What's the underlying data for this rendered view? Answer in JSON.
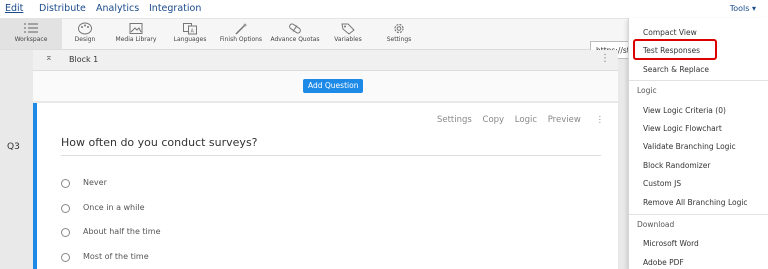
{
  "nav": {
    "tabs": [
      {
        "label": "Edit",
        "active": true
      },
      {
        "label": "Distribute"
      },
      {
        "label": "Analytics"
      },
      {
        "label": "Integration"
      }
    ],
    "tools_label": "Tools"
  },
  "toolbar": {
    "items": [
      {
        "label": "Workspace",
        "icon": "list-icon"
      },
      {
        "label": "Design",
        "icon": "palette-icon"
      },
      {
        "label": "Media Library",
        "icon": "image-icon"
      },
      {
        "label": "Languages",
        "icon": "translate-icon"
      },
      {
        "label": "Finish Options",
        "icon": "wand-icon"
      },
      {
        "label": "Advance Quotas",
        "icon": "pill-icon"
      },
      {
        "label": "Variables",
        "icon": "tag-icon"
      },
      {
        "label": "Settings",
        "icon": "gear-icon"
      }
    ],
    "url_text": "https://st"
  },
  "block": {
    "title": "Block 1",
    "add_question_label": "Add Question"
  },
  "question": {
    "number": "Q3",
    "actions": [
      "Settings",
      "Copy",
      "Logic",
      "Preview"
    ],
    "text": "How often do you conduct surveys?",
    "choices": [
      "Never",
      "Once in a while",
      "About half the time",
      "Most of the time"
    ]
  },
  "tools_menu": {
    "items_top": [
      "Compact View",
      "Test Responses",
      "Search & Replace"
    ],
    "logic_header": "Logic",
    "logic_items": [
      "View Logic Criteria (0)",
      "View Logic Flowchart",
      "Validate Branching Logic",
      "Block Randomizer",
      "Custom JS",
      "Remove All Branching Logic"
    ],
    "download_header": "Download",
    "download_items": [
      "Microsoft Word",
      "Adobe PDF"
    ],
    "highlighted_item": "Test Responses",
    "highlight_color": "#d00000"
  },
  "colors": {
    "accent": "#1e8ae8",
    "nav_text": "#1a4b8c"
  }
}
